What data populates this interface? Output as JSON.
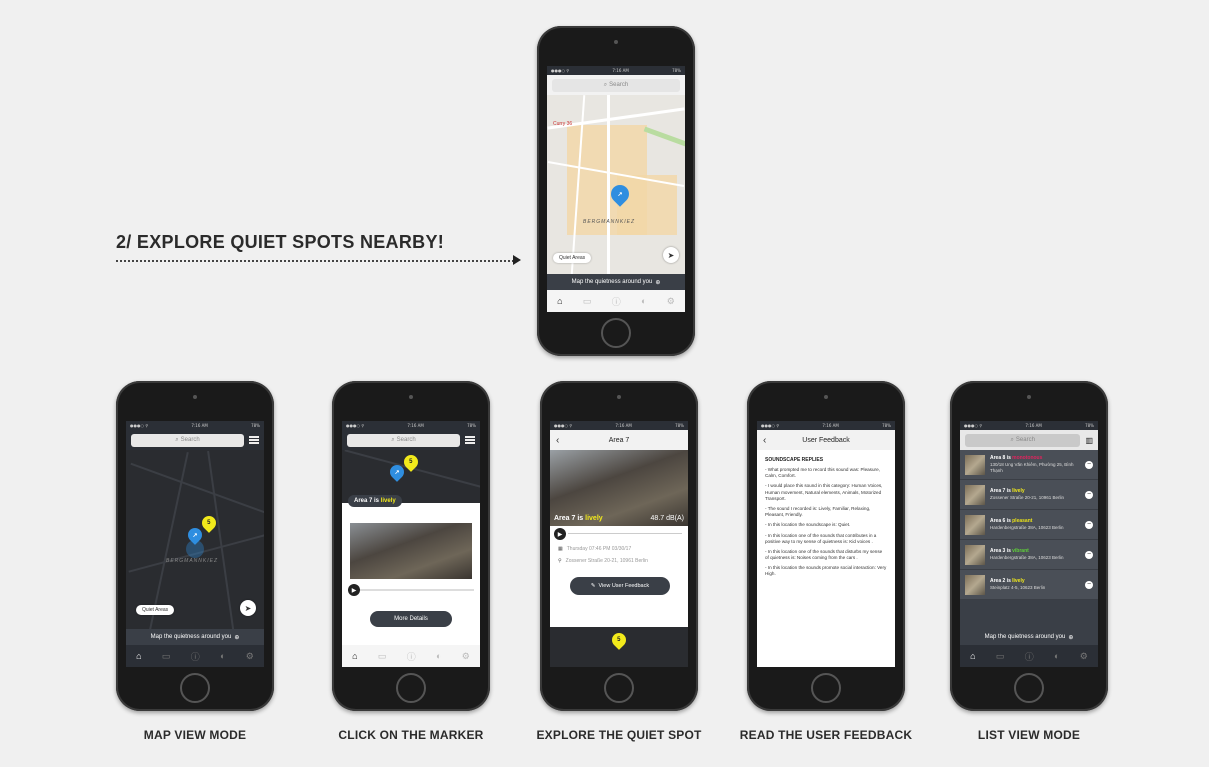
{
  "headline": "2/ EXPLORE QUIET SPOTS NEARBY!",
  "captions": {
    "map_view": "MAP VIEW MODE",
    "click_marker": "CLICK ON THE MARKER",
    "explore_spot": "EXPLORE THE QUIET SPOT",
    "read_feedback": "READ THE USER FEEDBACK",
    "list_view": "LIST VIEW MODE"
  },
  "status": {
    "carrier": "●●●○ ⚲",
    "time": "7:16 AM",
    "battery": "78%"
  },
  "search": {
    "placeholder": "Search"
  },
  "map": {
    "district": "BERGMANNKIEZ",
    "quiet_areas_button": "Quiet Areas",
    "map_quietness": "Map the quietness around you",
    "poi_curry": "Curry 36",
    "marker_number": "5"
  },
  "marker_card": {
    "area_label": "Area 7 is",
    "area_status": "lively",
    "more_details": "More Details"
  },
  "detail": {
    "title": "Area 7",
    "overlay_label": "Area 7 is",
    "overlay_status": "lively",
    "db_value": "48.7 dB(A)",
    "datetime": "Thursday 07:46 PM 03/30/17",
    "address": "Zossener Straße 20-21, 10961 Berlin",
    "view_feedback": "View User Feedback"
  },
  "feedback": {
    "title": "User Feedback",
    "heading": "SOUNDSCAPE REPLIES",
    "lines": [
      "- What prompted me to record this sound was: Pleasure, Calm, Comfort.",
      "- I would place this sound in this category: Human Voices, Human movement, Natural elements, Animals, Motorized Transport.",
      "- The sound I recorded is: Lively, Familiar, Relaxing, Pleasant, Friendly.",
      "- In this location the soundscape is: Quiet.",
      "- In this location one of the sounds that contributes in a positive way to my sense of quietness is: Kid voices .",
      "- In this location one of the sounds that disturbs my sense of quietness is: Noises coming from the cars .",
      "- In this location the sounds promote social interaction: Very High."
    ]
  },
  "list": {
    "items": [
      {
        "name": "Area 8 is",
        "status": "monotonous",
        "status_color": "#e0245e",
        "addr": "130/18 Ung Văn Khiêm, Phường 25, Bình Thạnh"
      },
      {
        "name": "Area 7 is",
        "status": "lively",
        "status_color": "#f2ea1b",
        "addr": "Zossener Straße 20-21, 10961 Berlin"
      },
      {
        "name": "Area 6 is",
        "status": "pleasant",
        "status_color": "#e8e01a",
        "addr": "Hardenbergstraße 38A, 10623 Berlin"
      },
      {
        "name": "Area 3 is",
        "status": "vibrant",
        "status_color": "#5fcf3a",
        "addr": "Hardenbergstraße 38A, 10623 Berlin"
      },
      {
        "name": "Area 2 is",
        "status": "lively",
        "status_color": "#f2ea1b",
        "addr": "Steinplatz 4-5, 10623 Berlin"
      }
    ]
  },
  "colors": {
    "accent_blue": "#2f8ee0",
    "marker_yellow": "#f2ea1b",
    "dark_ui": "#2b2f36"
  },
  "icons": [
    "home-icon",
    "bus-icon",
    "info-icon",
    "speech-icon",
    "settings-icon",
    "navigate-icon",
    "search-icon",
    "list-icon",
    "back-icon",
    "play-icon",
    "calendar-icon",
    "location-pin-icon",
    "feedback-icon",
    "add-circle-icon"
  ]
}
